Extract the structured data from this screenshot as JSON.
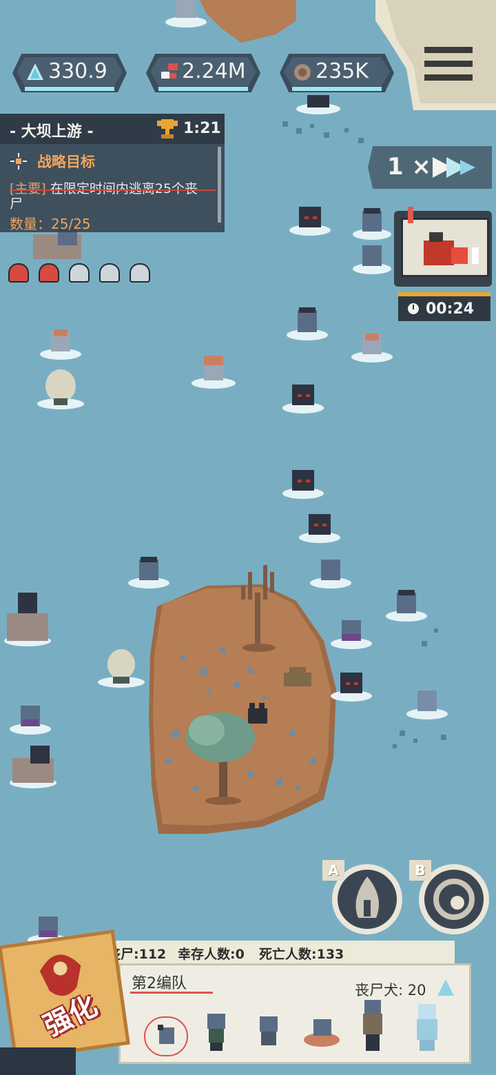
{
  "resources": {
    "crystal": {
      "value": "330.9",
      "icon": "crystal-icon"
    },
    "parts": {
      "value": "2.24M",
      "icon": "parts-icon"
    },
    "bones": {
      "value": "235K",
      "icon": "bone-icon"
    }
  },
  "objective": {
    "location": "- 大坝上游 -",
    "timer": "1:21",
    "section_title": "战略目标",
    "task_tag": "[主要]",
    "task_text": " 在限定时间内逃离25个丧尸",
    "count_label": "数量：",
    "count_value": "25/25"
  },
  "lives": {
    "total": 5,
    "filled": 2
  },
  "speed": {
    "label": "1 ×"
  },
  "tv": {
    "timer": "00:24"
  },
  "bottom": {
    "zombies": "丧尸:112",
    "survivors": "幸存人数:0",
    "deaths": "死亡人数:133",
    "team_name": "第2编队",
    "dog_label": "丧尸犬: 20",
    "strengthen": "强化"
  },
  "skills": {
    "a_key": "A",
    "b_key": "B"
  },
  "colors": {
    "water": "#79aec2",
    "island": "#b57e55",
    "accent": "#e9a534"
  }
}
